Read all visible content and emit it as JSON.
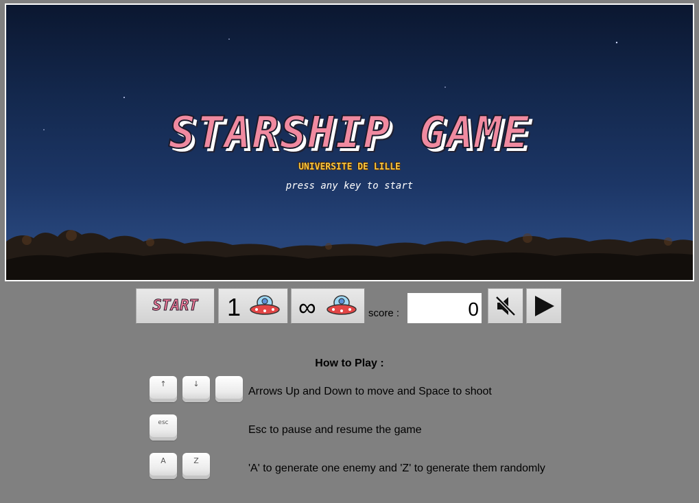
{
  "screen": {
    "title": "STARSHIP GAME",
    "subtitle": "UNIVERSITE DE LILLE",
    "prompt": "press any key to start"
  },
  "controls": {
    "start_label": "START",
    "one_enemy_label": "1",
    "infinite_enemies_label": "∞",
    "score_label": "score :",
    "score_value": "0",
    "mute_icon": "speaker-muted-icon",
    "play_icon": "play-icon"
  },
  "help": {
    "title": "How to Play :",
    "rows": [
      {
        "keys": [
          "↑",
          "↓",
          ""
        ],
        "text": "Arrows Up and Down to move and Space to shoot"
      },
      {
        "keys": [
          "esc"
        ],
        "text": "Esc to pause and resume the game"
      },
      {
        "keys": [
          "A",
          "Z"
        ],
        "text": "'A' to generate one enemy and 'Z' to generate them randomly"
      }
    ]
  },
  "colors": {
    "page_background": "#808080",
    "title_pink": "#f08aa0",
    "subtitle_gold": "#f5c542",
    "sky_dark": "#0b1730"
  }
}
